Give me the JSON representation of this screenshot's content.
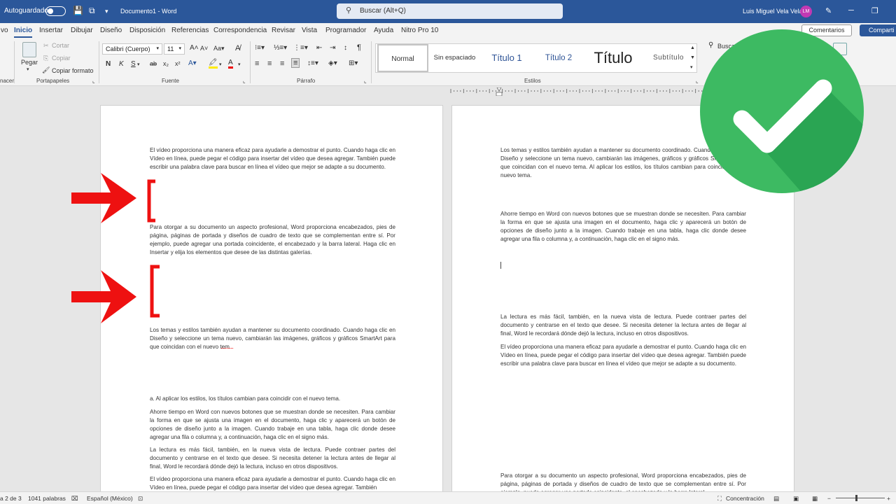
{
  "titlebar": {
    "autosave_label": "Autoguardado",
    "document_title": "Documento1  -  Word",
    "search_placeholder": "Buscar (Alt+Q)",
    "user_name": "Luis Miguel Vela Vela",
    "avatar_initials": "LM"
  },
  "tabs": {
    "items": [
      "vo",
      "Inicio",
      "Insertar",
      "Dibujar",
      "Diseño",
      "Disposición",
      "Referencias",
      "Correspondencia",
      "Revisar",
      "Vista",
      "Programador",
      "Ayuda",
      "Nitro Pro 10"
    ],
    "active": "Inicio",
    "comments": "Comentarios",
    "share": "Comparti"
  },
  "ribbon": {
    "clipboard": {
      "paste": "Pegar",
      "cut": "Cortar",
      "copy": "Copiar",
      "format_painter": "Copiar formato",
      "group": "Portapapeles",
      "left_group": "nacer"
    },
    "font": {
      "family": "Calibri (Cuerpo)",
      "size": "11",
      "group": "Fuente",
      "bold": "N",
      "italic": "K",
      "underline": "S"
    },
    "paragraph": {
      "group": "Párrafo"
    },
    "styles": {
      "group": "Estilos",
      "items": [
        "Normal",
        "Sin espaciado",
        "Título 1",
        "Título 2",
        "Título",
        "Subtítulo"
      ]
    },
    "editing": {
      "search": "Busca"
    }
  },
  "page1": {
    "p1": "El vídeo proporciona una manera eficaz para ayudarle a demostrar el punto. Cuando haga clic en Vídeo en línea, puede pegar el código para insertar del vídeo que desea agregar. También puede escribir una palabra clave para buscar en línea el vídeo que mejor se adapte a su documento.",
    "p2": "Para otorgar a su documento un aspecto profesional, Word proporciona encabezados, pies de página, páginas de portada y diseños de cuadro de texto que se complementan entre sí. Por ejemplo, puede agregar una portada coincidente, el encabezado y la barra lateral. Haga clic en Insertar y elija los elementos que desee de las distintas galerías.",
    "p3": "Los temas y estilos también ayudan a mantener su documento coordinado. Cuando haga clic en Diseño y seleccione un tema nuevo, cambiarán las imágenes, gráficos y gráficos SmartArt para que coincidan con el nuevo tem",
    "p4": "a. Al aplicar los estilos, los títulos cambian para coincidir con el nuevo tema.",
    "p5": "Ahorre tiempo en Word con nuevos botones que se muestran donde se necesiten. Para cambiar la forma en que se ajusta una imagen en el documento, haga clic y aparecerá un botón de opciones de diseño junto a la imagen. Cuando trabaje en una tabla, haga clic donde desee agregar una fila o columna y, a continuación, haga clic en el signo más.",
    "p6": "La lectura es más fácil, también, en la nueva vista de lectura. Puede contraer partes del documento y centrarse en el texto que desee. Si necesita detener la lectura antes de llegar al final, Word le recordará dónde dejó la lectura, incluso en otros dispositivos.",
    "p7": "El vídeo proporciona una manera eficaz para ayudarle a demostrar el punto. Cuando haga clic en Vídeo en línea, puede pegar el código para insertar del vídeo que desea agregar. También"
  },
  "page2": {
    "p1": "Los temas y estilos también ayudan a mantener su documento coordinado. Cuando haga clic en Diseño y seleccione un tema nuevo, cambiarán las imágenes, gráficos y gráficos SmartArt para que coincidan con el nuevo tema. Al aplicar los estilos, los títulos cambian para coincidir con el nuevo tema.",
    "p2": "Ahorre tiempo en Word con nuevos botones que se muestran donde se necesiten. Para cambiar la forma en que se ajusta una imagen en el documento, haga clic y aparecerá un botón de opciones de diseño junto a la imagen. Cuando trabaje en una tabla, haga clic donde desee agregar una fila o columna y, a continuación, haga clic en el signo más.",
    "p3": "La lectura es más fácil, también, en la nueva vista de lectura. Puede contraer partes del documento y centrarse en el texto que desee. Si necesita detener la lectura antes de llegar al final, Word le recordará dónde dejó la lectura, incluso en otros dispositivos.",
    "p4": "El vídeo proporciona una manera eficaz para ayudarle a demostrar el punto. Cuando haga clic en Vídeo en línea, puede pegar el código para insertar del vídeo que desea agregar. También puede escribir una palabra clave para buscar en línea el vídeo que mejor se adapte a su documento.",
    "p5": "Para otorgar a su documento un aspecto profesional, Word proporciona encabezados, pies de página, páginas de portada y diseños de cuadro de texto que se complementan entre sí. Por ejemplo, puede agregar una portada coincidente, el encabezado y la barra lateral."
  },
  "statusbar": {
    "page": "a 2 de 3",
    "words": "1041 palabras",
    "language": "Español (México)",
    "focus": "Concentración"
  },
  "colors": {
    "title_bar": "#2b579a",
    "arrow_red": "#ee1111",
    "check_green": "#3dba62"
  }
}
